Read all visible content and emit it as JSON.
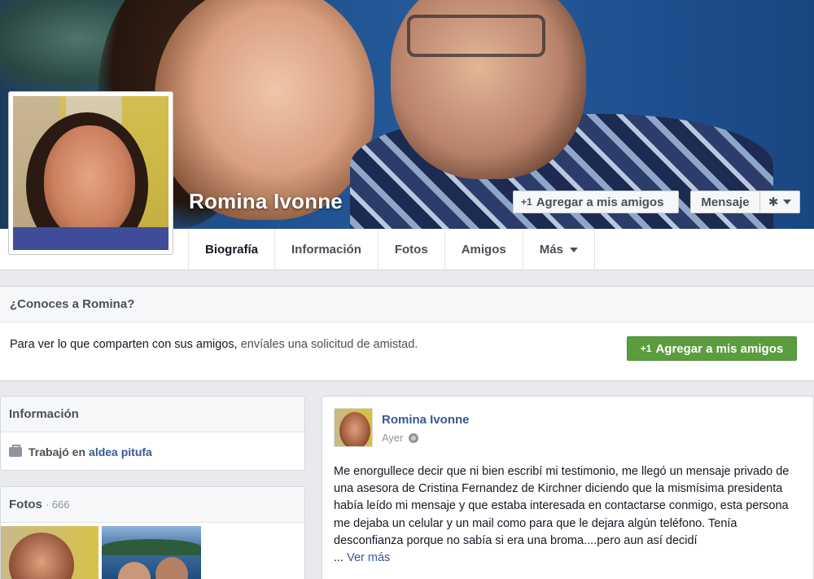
{
  "profile": {
    "name": "Romina Ivonne",
    "add_friend_label": "Agregar a mis amigos",
    "plus_one": "+1",
    "message_label": "Mensaje"
  },
  "tabs": [
    {
      "label": "Biografía"
    },
    {
      "label": "Información"
    },
    {
      "label": "Fotos"
    },
    {
      "label": "Amigos"
    },
    {
      "label": "Más"
    }
  ],
  "know_box": {
    "title": "¿Conoces a Romina?",
    "text_main": "Para ver lo que comparten con sus amigos,",
    "text_muted": " envíales una solicitud de amistad.",
    "button_label": "Agregar a mis amigos",
    "button_plus": "+1"
  },
  "info_card": {
    "title": "Información",
    "work_prefix": "Trabajó en",
    "work_place": "aldea pitufa"
  },
  "photos_card": {
    "title": "Fotos",
    "count": "· 666"
  },
  "post": {
    "author": "Romina Ivonne",
    "time": "Ayer",
    "text": "Me enorgullece decir que ni bien escribí mi testimonio, me llegó un mensaje privado de una asesora de Cristina Fernandez de Kirchner diciendo que la mismísima presidenta había leído mi mensaje y que estaba interesada en contactarse conmigo, esta persona me dejaba un celular y un mail como para que le dejara algún teléfono. Tenía desconfianza porque no sabía si era una broma....pero aun así decidí",
    "ellipsis": "...",
    "see_more": "Ver más"
  },
  "colors": {
    "link": "#365899",
    "green_button": "#5b9d3e",
    "page_bg": "#e9eaed"
  }
}
